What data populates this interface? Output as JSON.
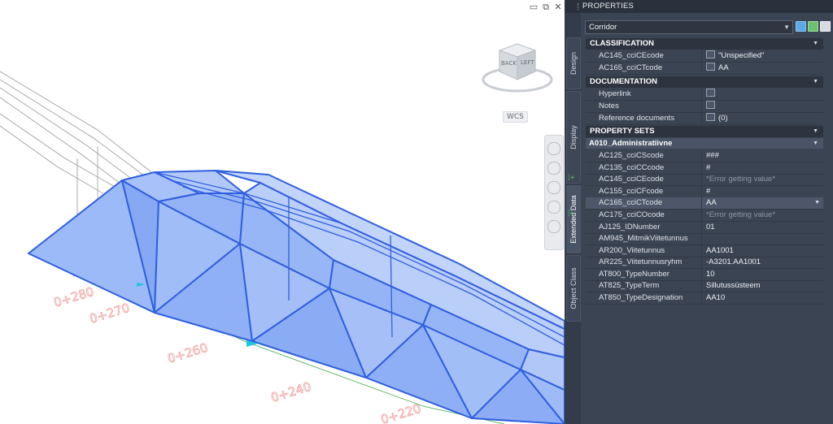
{
  "window_controls": {
    "minimize": "▭",
    "restore": "⧉",
    "close": "✕"
  },
  "viewcube": {
    "back": "BACK",
    "left": "LEFT"
  },
  "wcs_label": "WCS",
  "stations": [
    "0+280",
    "0+270",
    "0+260",
    "0+240",
    "0+220"
  ],
  "panel": {
    "title": "PROPERTIES",
    "object_type": "Corridor",
    "side_tabs": [
      "Design",
      "Display",
      "Extended Data",
      "Object Class"
    ],
    "active_tab": "Extended Data",
    "sections": {
      "classification": {
        "title": "CLASSIFICATION",
        "rows": [
          {
            "name": "AC145_cciCEcode",
            "value": "\"Unspecified\""
          },
          {
            "name": "AC165_cciCTcode",
            "value": "AA"
          }
        ]
      },
      "documentation": {
        "title": "DOCUMENTATION",
        "rows": [
          {
            "name": "Hyperlink",
            "value": ""
          },
          {
            "name": "Notes",
            "value": ""
          },
          {
            "name": "Reference documents",
            "value": "(0)"
          }
        ]
      },
      "property_sets": {
        "title": "PROPERTY SETS",
        "subsection": "A010_Administratiivne",
        "rows": [
          {
            "name": "AC125_cciCScode",
            "value": "###"
          },
          {
            "name": "AC135_cciCCcode",
            "value": "#"
          },
          {
            "name": "AC145_cciCEcode",
            "value": "*Error getting value*"
          },
          {
            "name": "AC155_cciCFcode",
            "value": "#"
          },
          {
            "name": "AC165_cciCTcode",
            "value": "AA"
          },
          {
            "name": "AC175_cciCOcode",
            "value": "*Error getting value*"
          },
          {
            "name": "AJ125_IDNumber",
            "value": "01"
          },
          {
            "name": "AM945_MitmikViitetunnus",
            "value": ""
          },
          {
            "name": "AR200_Viitetunnus",
            "value": "AA1001"
          },
          {
            "name": "AR225_Viitetunnusryhm",
            "value": "-A3201.AA1001"
          },
          {
            "name": "AT800_TypeNumber",
            "value": "10"
          },
          {
            "name": "AT825_TypeTerm",
            "value": "Sillutussüsteem"
          },
          {
            "name": "AT850_TypeDesignation",
            "value": "AA10"
          }
        ]
      }
    }
  },
  "colors": {
    "panel_bg": "#3b4453",
    "section_bg": "#2d343f",
    "corridor_fill": "#8fb0f5",
    "corridor_edge": "#2f5fe0",
    "station_text": "#f2a3a3"
  }
}
